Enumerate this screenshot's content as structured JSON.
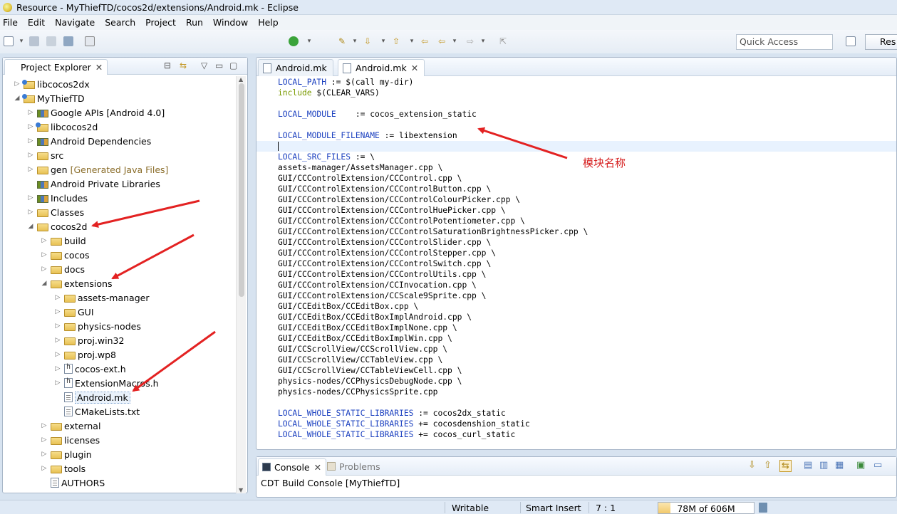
{
  "window": {
    "title": "Resource - MyThiefTD/cocos2d/extensions/Android.mk - Eclipse"
  },
  "menu": [
    "File",
    "Edit",
    "Navigate",
    "Search",
    "Project",
    "Run",
    "Window",
    "Help"
  ],
  "toolbar": {
    "quick_access_placeholder": "Quick Access",
    "perspective_label": "Res"
  },
  "project_explorer": {
    "tab_label": "Project Explorer",
    "items": [
      {
        "label": "libcocos2dx",
        "depth": 0,
        "expanded": false,
        "icon": "project-icon"
      },
      {
        "label": "MyThiefTD",
        "depth": 0,
        "expanded": true,
        "icon": "project-icon"
      },
      {
        "label": "Google APIs [Android 4.0]",
        "depth": 1,
        "expanded": false,
        "icon": "library-icon"
      },
      {
        "label": "libcocos2d",
        "depth": 1,
        "expanded": false,
        "icon": "project-icon"
      },
      {
        "label": "Android Dependencies",
        "depth": 1,
        "expanded": false,
        "icon": "library-icon"
      },
      {
        "label": "src",
        "depth": 1,
        "expanded": false,
        "icon": "package-folder-icon"
      },
      {
        "label": "gen",
        "suffix": "[Generated Java Files]",
        "depth": 1,
        "expanded": false,
        "icon": "package-folder-icon"
      },
      {
        "label": "Android Private Libraries",
        "depth": 1,
        "expanded": null,
        "icon": "library-icon"
      },
      {
        "label": "Includes",
        "depth": 1,
        "expanded": false,
        "icon": "includes-icon"
      },
      {
        "label": "Classes",
        "depth": 1,
        "expanded": false,
        "icon": "linked-folder-icon"
      },
      {
        "label": "cocos2d",
        "depth": 1,
        "expanded": true,
        "icon": "linked-folder-icon"
      },
      {
        "label": "build",
        "depth": 2,
        "expanded": false,
        "icon": "folder-icon"
      },
      {
        "label": "cocos",
        "depth": 2,
        "expanded": false,
        "icon": "folder-icon"
      },
      {
        "label": "docs",
        "depth": 2,
        "expanded": false,
        "icon": "folder-icon"
      },
      {
        "label": "extensions",
        "depth": 2,
        "expanded": true,
        "icon": "folder-icon"
      },
      {
        "label": "assets-manager",
        "depth": 3,
        "expanded": false,
        "icon": "folder-icon"
      },
      {
        "label": "GUI",
        "depth": 3,
        "expanded": false,
        "icon": "folder-icon"
      },
      {
        "label": "physics-nodes",
        "depth": 3,
        "expanded": false,
        "icon": "folder-icon"
      },
      {
        "label": "proj.win32",
        "depth": 3,
        "expanded": false,
        "icon": "folder-icon"
      },
      {
        "label": "proj.wp8",
        "depth": 3,
        "expanded": false,
        "icon": "folder-icon"
      },
      {
        "label": "cocos-ext.h",
        "depth": 3,
        "expanded": false,
        "icon": "header-file-icon"
      },
      {
        "label": "ExtensionMacros.h",
        "depth": 3,
        "expanded": false,
        "icon": "header-file-icon"
      },
      {
        "label": "Android.mk",
        "depth": 3,
        "expanded": null,
        "icon": "text-file-icon",
        "selected": true
      },
      {
        "label": "CMakeLists.txt",
        "depth": 3,
        "expanded": null,
        "icon": "text-file-icon"
      },
      {
        "label": "external",
        "depth": 2,
        "expanded": false,
        "icon": "folder-icon"
      },
      {
        "label": "licenses",
        "depth": 2,
        "expanded": false,
        "icon": "folder-icon"
      },
      {
        "label": "plugin",
        "depth": 2,
        "expanded": false,
        "icon": "folder-icon"
      },
      {
        "label": "tools",
        "depth": 2,
        "expanded": false,
        "icon": "folder-icon"
      },
      {
        "label": "AUTHORS",
        "depth": 2,
        "expanded": null,
        "icon": "text-file-icon"
      }
    ]
  },
  "editor": {
    "tabs": [
      {
        "label": "Android.mk",
        "active": false
      },
      {
        "label": "Android.mk",
        "active": true
      }
    ],
    "lines": [
      [
        [
          "kw",
          "LOCAL_PATH"
        ],
        [
          "",
          " := $(call my-dir)"
        ]
      ],
      [
        [
          "inc",
          "include"
        ],
        [
          "",
          " $(CLEAR_VARS)"
        ]
      ],
      [],
      [
        [
          "kw",
          "LOCAL_MODULE"
        ],
        [
          "",
          "    := cocos_extension_static"
        ]
      ],
      [],
      [
        [
          "kw",
          "LOCAL_MODULE_FILENAME"
        ],
        [
          "",
          " := libextension"
        ]
      ],
      [],
      [
        [
          "kw",
          "LOCAL_SRC_FILES"
        ],
        [
          "",
          " := \\"
        ]
      ],
      [
        [
          "",
          "assets-manager/AssetsManager.cpp \\"
        ]
      ],
      [
        [
          "",
          "GUI/CCControlExtension/CCControl.cpp \\"
        ]
      ],
      [
        [
          "",
          "GUI/CCControlExtension/CCControlButton.cpp \\"
        ]
      ],
      [
        [
          "",
          "GUI/CCControlExtension/CCControlColourPicker.cpp \\"
        ]
      ],
      [
        [
          "",
          "GUI/CCControlExtension/CCControlHuePicker.cpp \\"
        ]
      ],
      [
        [
          "",
          "GUI/CCControlExtension/CCControlPotentiometer.cpp \\"
        ]
      ],
      [
        [
          "",
          "GUI/CCControlExtension/CCControlSaturationBrightnessPicker.cpp \\"
        ]
      ],
      [
        [
          "",
          "GUI/CCControlExtension/CCControlSlider.cpp \\"
        ]
      ],
      [
        [
          "",
          "GUI/CCControlExtension/CCControlStepper.cpp \\"
        ]
      ],
      [
        [
          "",
          "GUI/CCControlExtension/CCControlSwitch.cpp \\"
        ]
      ],
      [
        [
          "",
          "GUI/CCControlExtension/CCControlUtils.cpp \\"
        ]
      ],
      [
        [
          "",
          "GUI/CCControlExtension/CCInvocation.cpp \\"
        ]
      ],
      [
        [
          "",
          "GUI/CCControlExtension/CCScale9Sprite.cpp \\"
        ]
      ],
      [
        [
          "",
          "GUI/CCEditBox/CCEditBox.cpp \\"
        ]
      ],
      [
        [
          "",
          "GUI/CCEditBox/CCEditBoxImplAndroid.cpp \\"
        ]
      ],
      [
        [
          "",
          "GUI/CCEditBox/CCEditBoxImplNone.cpp \\"
        ]
      ],
      [
        [
          "",
          "GUI/CCEditBox/CCEditBoxImplWin.cpp \\"
        ]
      ],
      [
        [
          "",
          "GUI/CCScrollView/CCScrollView.cpp \\"
        ]
      ],
      [
        [
          "",
          "GUI/CCScrollView/CCTableView.cpp \\"
        ]
      ],
      [
        [
          "",
          "GUI/CCScrollView/CCTableViewCell.cpp \\"
        ]
      ],
      [
        [
          "",
          "physics-nodes/CCPhysicsDebugNode.cpp \\"
        ]
      ],
      [
        [
          "",
          "physics-nodes/CCPhysicsSprite.cpp"
        ]
      ],
      [],
      [
        [
          "kw",
          "LOCAL_WHOLE_STATIC_LIBRARIES"
        ],
        [
          "",
          " := cocos2dx_static"
        ]
      ],
      [
        [
          "kw",
          "LOCAL_WHOLE_STATIC_LIBRARIES"
        ],
        [
          "",
          " += cocosdenshion_static"
        ]
      ],
      [
        [
          "kw",
          "LOCAL_WHOLE_STATIC_LIBRARIES"
        ],
        [
          "",
          " += cocos_curl_static"
        ]
      ]
    ],
    "annotation": "模块名称"
  },
  "console": {
    "tabs": [
      {
        "label": "Console",
        "active": true
      },
      {
        "label": "Problems",
        "active": false
      }
    ],
    "body": "CDT Build Console [MyThiefTD]"
  },
  "status_bar": {
    "writable": "Writable",
    "insert_mode": "Smart Insert",
    "position": "7 : 1",
    "heap": "78M of 606M",
    "heap_fraction": 0.13
  },
  "colors": {
    "keyword": "#1a3fbf",
    "annotation": "#d62020",
    "accent": "#d7e3f0"
  }
}
